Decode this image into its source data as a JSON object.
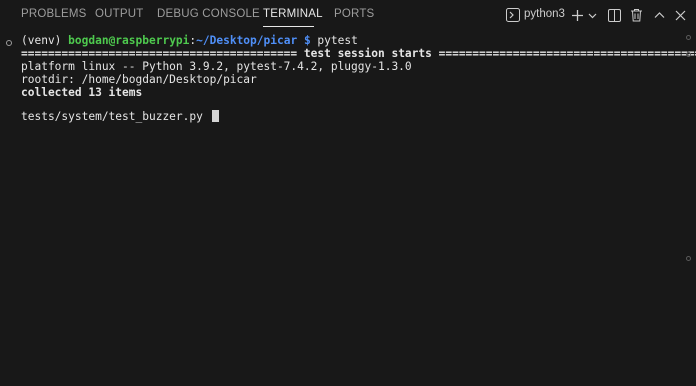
{
  "tabs": [
    {
      "label": "PROBLEMS"
    },
    {
      "label": "OUTPUT"
    },
    {
      "label": "DEBUG CONSOLE"
    },
    {
      "label": "TERMINAL"
    },
    {
      "label": "PORTS"
    }
  ],
  "active_tab": "TERMINAL",
  "actions": {
    "profile_label": "python3",
    "icons": [
      "terminal-icon",
      "plus-icon",
      "chevron-down-icon",
      "split-icon",
      "trash-icon",
      "chevron-up-icon",
      "close-icon"
    ]
  },
  "terminal": {
    "prompt": {
      "venv": "(venv) ",
      "user_host": "bogdan@raspberrypi",
      "colon": ":",
      "path": "~/Desktop/picar",
      "dollar": " $ ",
      "command": "pytest"
    },
    "session_line": {
      "left": "=========================================",
      "title": " test session starts ",
      "right": "=========================================="
    },
    "platform": "platform linux -- Python 3.9.2, pytest-7.4.2, pluggy-1.3.0",
    "rootdir": "rootdir: /home/bogdan/Desktop/picar",
    "collected": "collected 13 items",
    "running": "tests/system/test_buzzer.py "
  }
}
